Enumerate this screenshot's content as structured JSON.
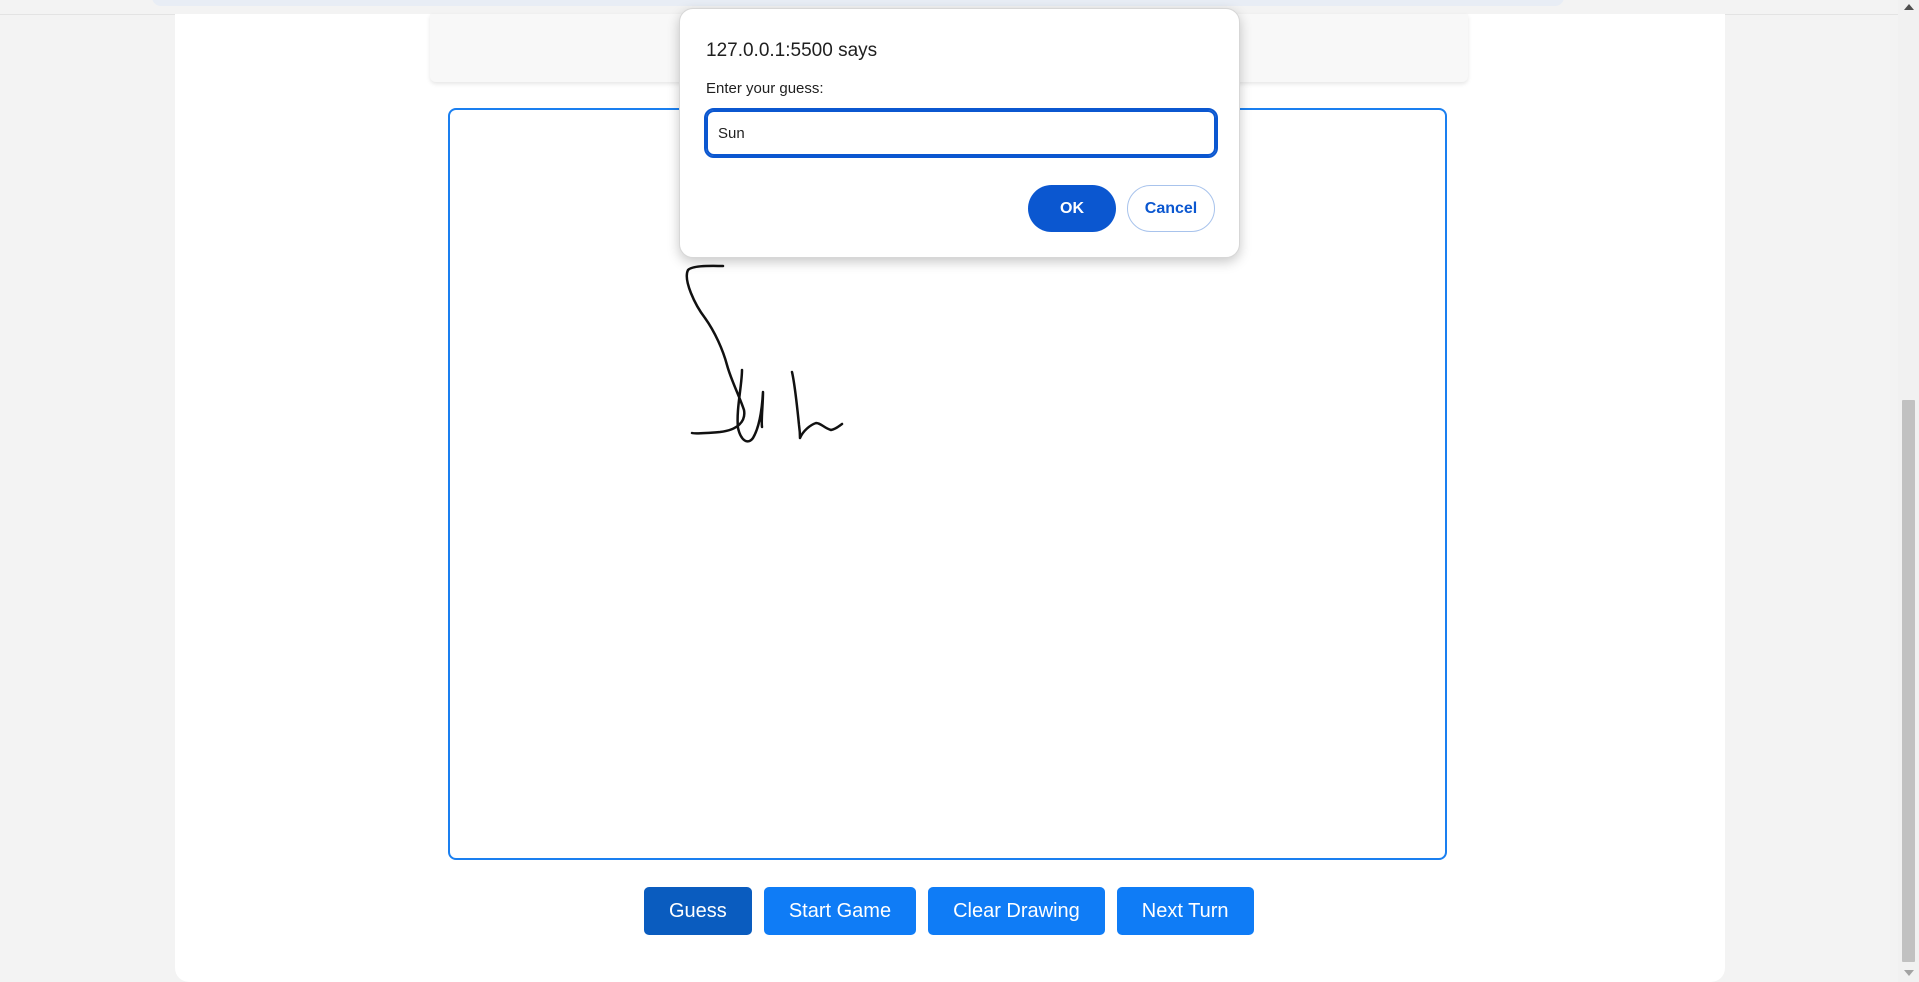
{
  "dialog": {
    "title": "127.0.0.1:5500 says",
    "message": "Enter your guess:",
    "input_value": "Sun",
    "ok_label": "OK",
    "cancel_label": "Cancel"
  },
  "buttons": {
    "guess": "Guess",
    "start_game": "Start Game",
    "clear_drawing": "Clear Drawing",
    "next_turn": "Next Turn"
  },
  "colors": {
    "accent": "#0f7cf6",
    "accent_active": "#0a5cbf",
    "dialog_primary": "#0b57d0",
    "canvas_border": "#1a7ff0"
  }
}
